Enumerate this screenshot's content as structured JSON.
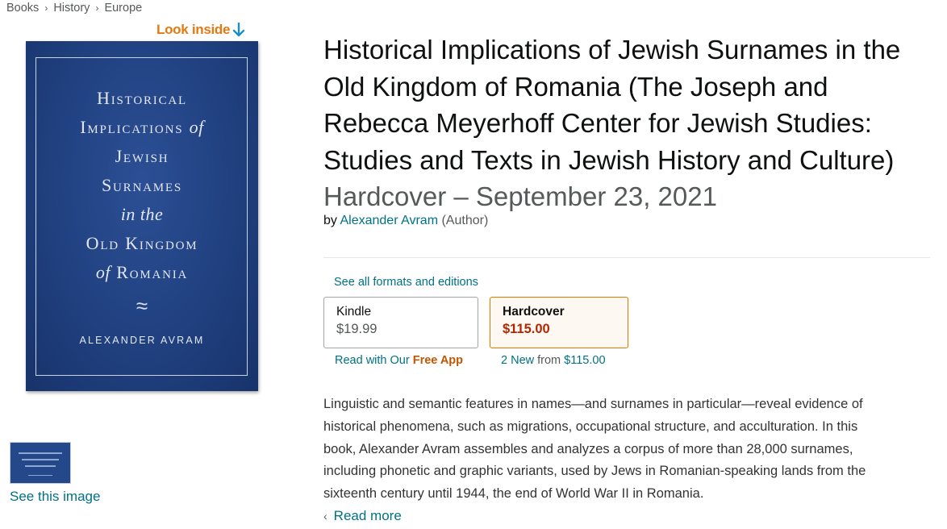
{
  "breadcrumb": [
    "Books",
    "History",
    "Europe"
  ],
  "look_inside": "Look inside",
  "cover": {
    "title_lines": [
      {
        "pre": "",
        "main": "Historical",
        "it": "",
        "post": ""
      },
      {
        "pre": "",
        "main": "Implications ",
        "it": "of",
        "post": ""
      },
      {
        "pre": "",
        "main": "Jewish",
        "it": "",
        "post": ""
      },
      {
        "pre": "",
        "main": "Surnames",
        "it": "",
        "post": ""
      },
      {
        "pre": "",
        "main": "",
        "it": "in the",
        "post": ""
      },
      {
        "pre": "",
        "main": "Old Kingdom",
        "it": "",
        "post": ""
      },
      {
        "pre": "of",
        "main": " Romania",
        "it": "",
        "post": ""
      }
    ],
    "author": "ALEXANDER AVRAM",
    "ornament": "≈"
  },
  "see_image": "See this image",
  "product": {
    "title": "Historical Implications of Jewish Surnames in the Old Kingdom of Romania (The Joseph and Rebecca Meyerhoff Center for Jewish Studies: Studies and Texts in Jewish History and Culture)",
    "format_date": "Hardcover – September 23, 2021",
    "by": "by",
    "author": "Alexander Avram",
    "role": "(Author)"
  },
  "formats": {
    "see_all": "See all formats and editions",
    "kindle": {
      "name": "Kindle",
      "price": "$19.99",
      "note_pre": "Read with Our ",
      "note_hl": "Free App"
    },
    "hardcover": {
      "name": "Hardcover",
      "price": "$115.00",
      "note_count": "2 New",
      "note_from": "from",
      "note_price": "$115.00"
    }
  },
  "description": [
    "Linguistic and semantic features in names—and surnames in particular—reveal evidence of",
    "historical phenomena, such as migrations, occupational structure, and acculturation. In this",
    "book, Alexander Avram assembles and analyzes a corpus of more than 28,000 surnames,",
    "including phonetic and graphic variants, used by Jews in Romanian-speaking lands from the",
    "sixteenth century until 1944, the end of World War II in Romania."
  ],
  "read_more": "Read more",
  "colors": {
    "link": "#007185",
    "price": "#b12704",
    "accent": "#e47911",
    "cover": "#20407f"
  }
}
